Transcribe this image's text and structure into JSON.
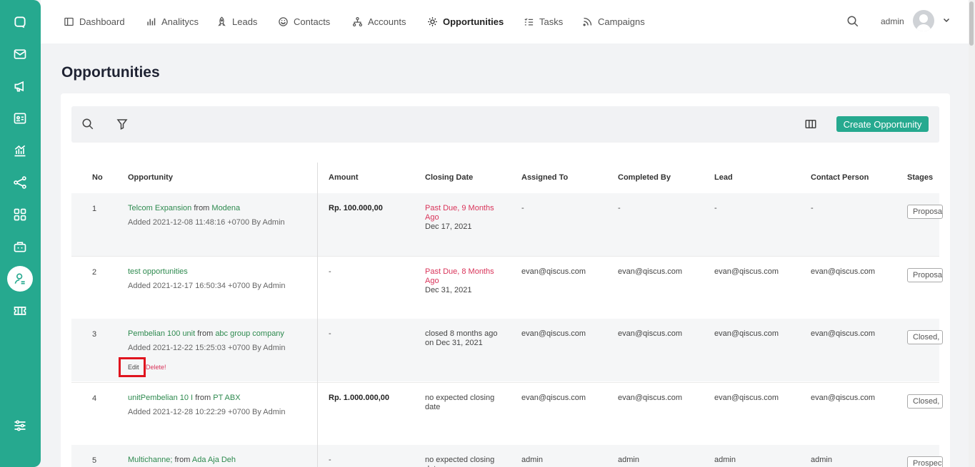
{
  "colors": {
    "brand": "#26a98f",
    "link": "#2e8a4f",
    "danger": "#d9345a",
    "highlight": "#e0141e"
  },
  "sidebar": {
    "icons": [
      "chat-icon",
      "mail-icon",
      "megaphone-icon",
      "contact-card-icon",
      "chart-icon",
      "share-icon",
      "apps-icon",
      "robot-icon",
      "user-pipeline-icon",
      "ticket-icon",
      "settings-sliders-icon"
    ],
    "active": "user-pipeline-icon"
  },
  "nav": {
    "items": [
      {
        "label": "Dashboard",
        "icon": "layout-icon"
      },
      {
        "label": "Analitycs",
        "icon": "bar-chart-icon"
      },
      {
        "label": "Leads",
        "icon": "rocket-icon"
      },
      {
        "label": "Contacts",
        "icon": "smiley-icon"
      },
      {
        "label": "Accounts",
        "icon": "hierarchy-icon"
      },
      {
        "label": "Opportunities",
        "icon": "sun-icon"
      },
      {
        "label": "Tasks",
        "icon": "checklist-icon"
      },
      {
        "label": "Campaigns",
        "icon": "rss-icon"
      }
    ],
    "active": "Opportunities",
    "user": "admin"
  },
  "page": {
    "title": "Opportunities"
  },
  "toolbar": {
    "create_label": "Create Opportunity"
  },
  "table": {
    "headers": {
      "no": "No",
      "opportunity": "Opportunity",
      "amount": "Amount",
      "closing": "Closing Date",
      "assigned": "Assigned To",
      "completed": "Completed By",
      "lead": "Lead",
      "contact": "Contact Person",
      "stages": "Stages"
    },
    "rows": [
      {
        "no": "1",
        "name": "Telcom Expansion",
        "from": "from",
        "company": "Modena",
        "added": "Added 2021-12-08 11:48:16 +0700 By Admin",
        "amount": "Rp. 100.000,00",
        "closing_status": "Past Due, 9 Months Ago",
        "closing_date": "Dec 17, 2021",
        "assigned": "-",
        "completed": "-",
        "lead": "-",
        "contact": "-",
        "stage": "Proposal"
      },
      {
        "no": "2",
        "name": "test opportunities",
        "from": "",
        "company": "",
        "added": "Added 2021-12-17 16:50:34 +0700 By Admin",
        "amount": "-",
        "closing_status": "Past Due, 8 Months Ago",
        "closing_date": "Dec 31, 2021",
        "assigned": "evan@qiscus.com",
        "completed": "evan@qiscus.com",
        "lead": "evan@qiscus.com",
        "contact": "evan@qiscus.com",
        "stage": "Proposal"
      },
      {
        "no": "3",
        "name": "Pembelian 100 unit",
        "from": "from",
        "company": "abc group company",
        "added": "Added 2021-12-22 15:25:03 +0700 By Admin",
        "amount": "-",
        "closing_text": "closed 8 months ago on Dec 31, 2021",
        "assigned": "evan@qiscus.com",
        "completed": "evan@qiscus.com",
        "lead": "evan@qiscus.com",
        "contact": "evan@qiscus.com",
        "stage": "Closed,",
        "edit": "Edit",
        "delete": "Delete!"
      },
      {
        "no": "4",
        "name": "unitPembelian 10 I",
        "from": "from",
        "company": "PT ABX",
        "added": "Added 2021-12-28 10:22:29 +0700 By Admin",
        "amount": "Rp. 1.000.000,00",
        "closing_text": "no expected closing date",
        "assigned": "evan@qiscus.com",
        "completed": "evan@qiscus.com",
        "lead": "evan@qiscus.com",
        "contact": "evan@qiscus.com",
        "stage": "Closed,",
        "edit": "",
        "delete": ""
      },
      {
        "no": "5",
        "name": "Multichanne;",
        "from": "from",
        "company": "Ada Aja Deh",
        "added": "",
        "amount": "-",
        "closing_text": "no expected closing date",
        "assigned": "admin",
        "completed": "admin",
        "lead": "admin",
        "contact": "admin",
        "stage": "Prospect"
      }
    ]
  }
}
